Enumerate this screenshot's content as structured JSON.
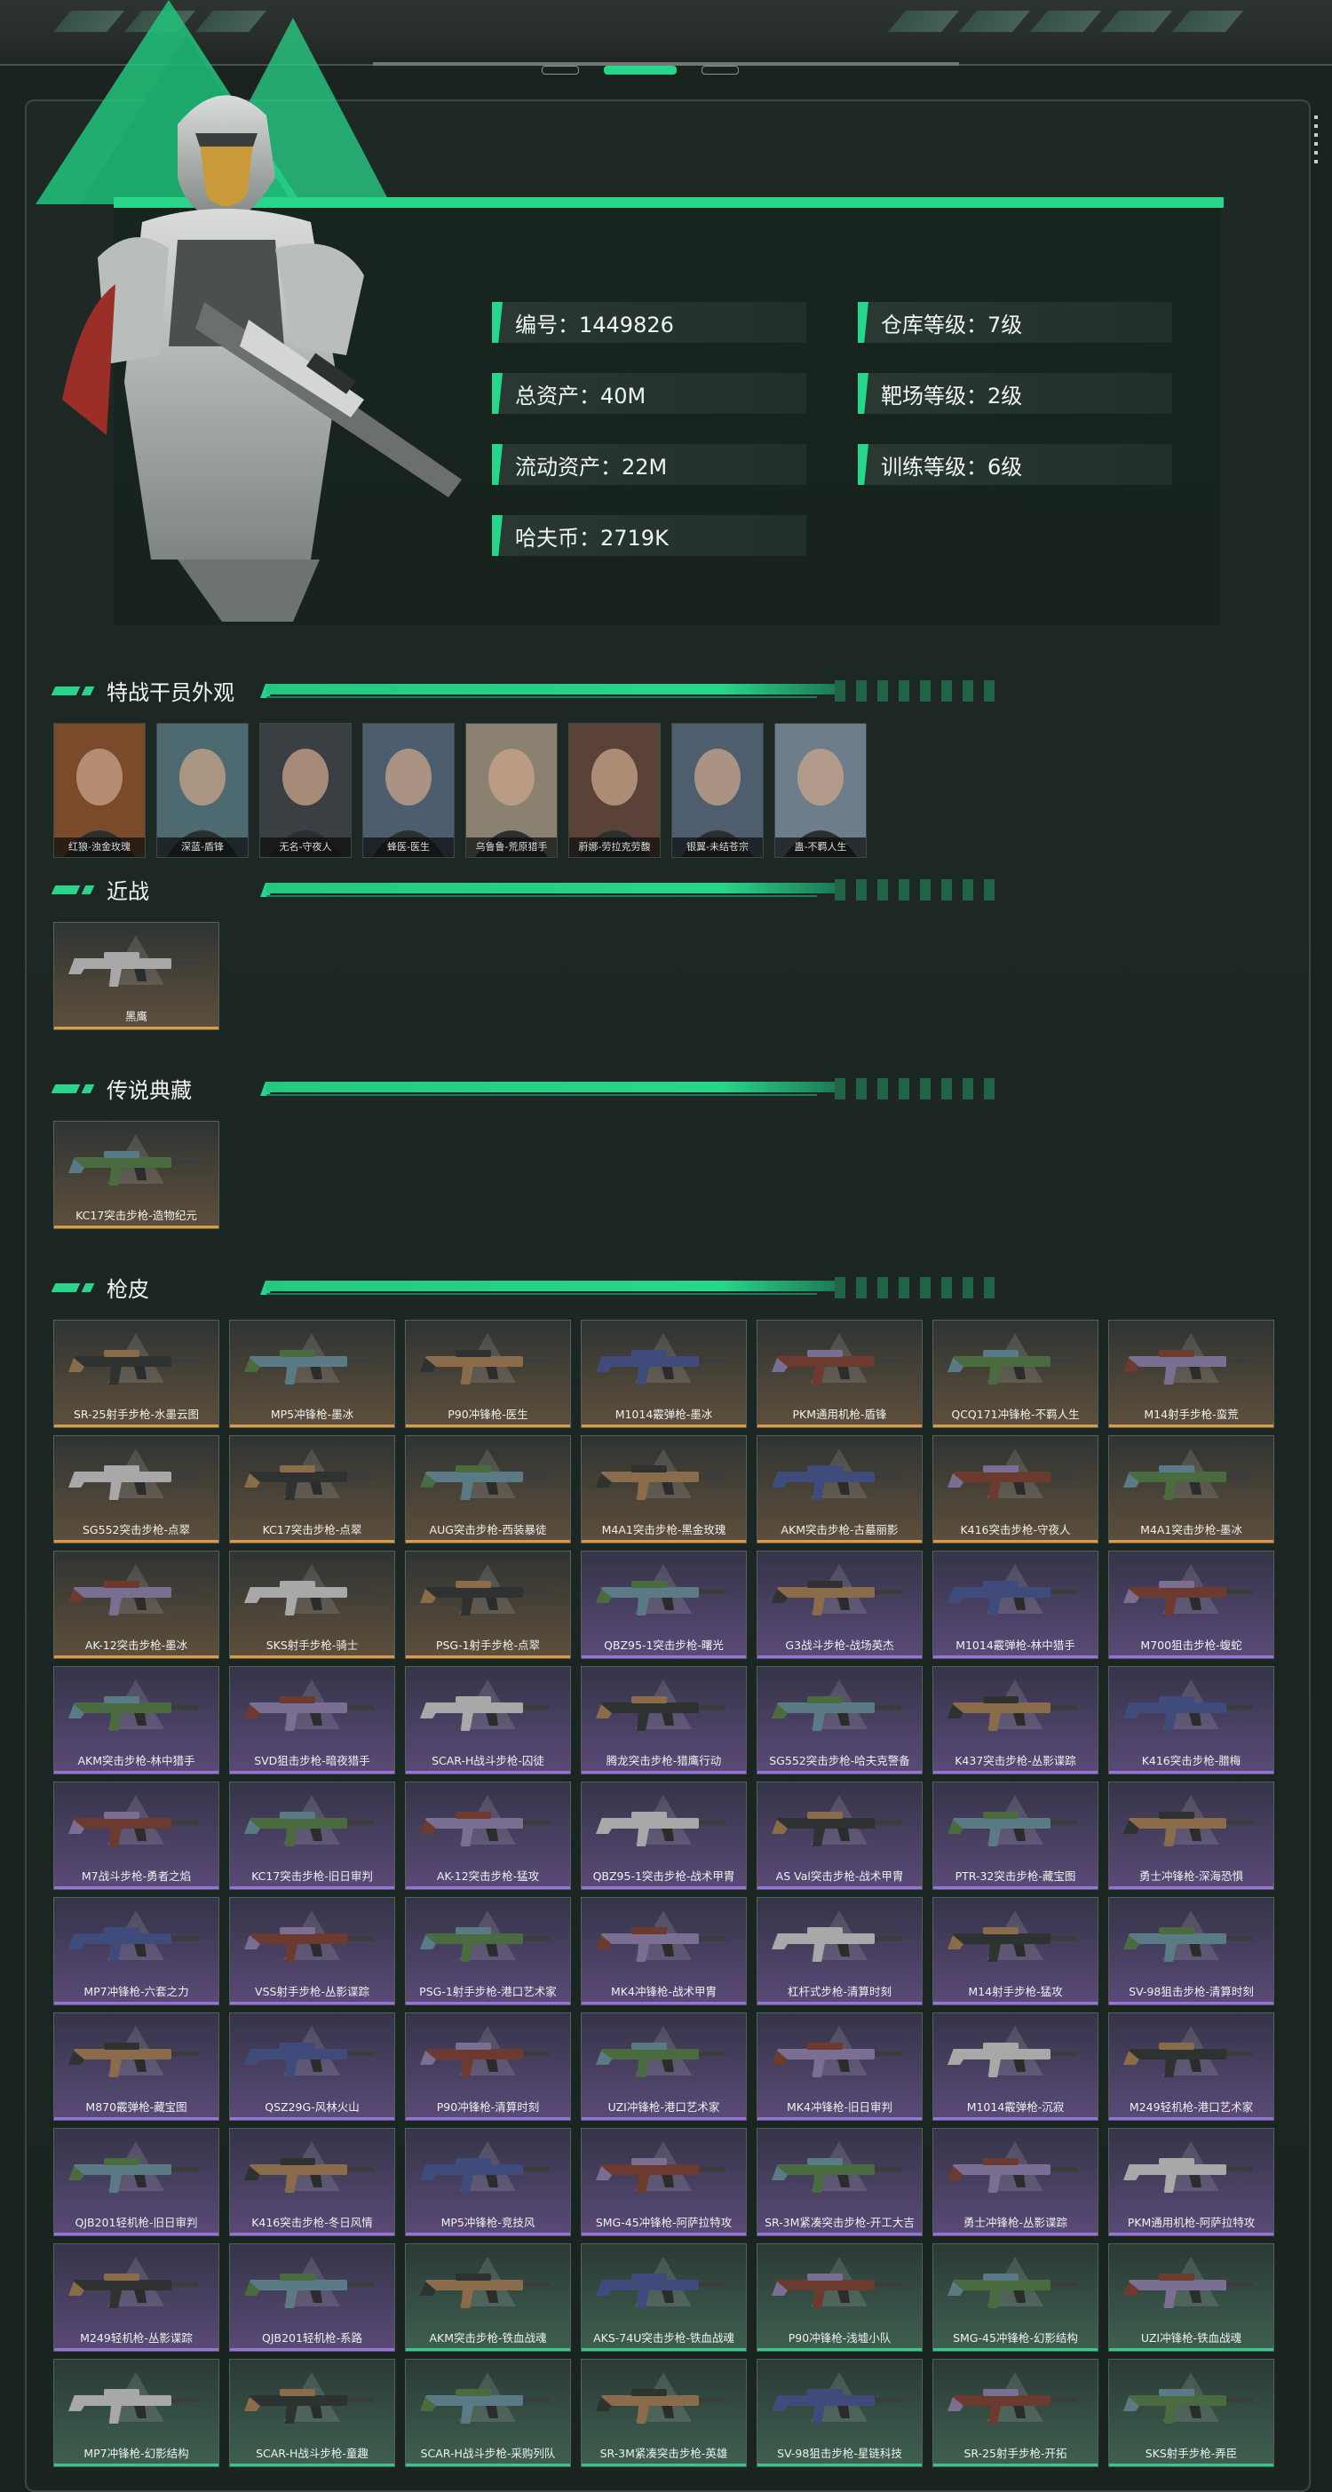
{
  "colors": {
    "accent": "#28d68b",
    "gold_rarity": "#e09a45",
    "purple_rarity": "#9a6fe0",
    "green_rarity": "#34c98a"
  },
  "profile": {
    "stats": [
      {
        "label": "编号：1449826"
      },
      {
        "label": "仓库等级：7级"
      },
      {
        "label": "总资产：40M"
      },
      {
        "label": "靶场等级：2级"
      },
      {
        "label": "流动资产：22M"
      },
      {
        "label": "训练等级：6级"
      },
      {
        "label": "哈夫币：2719K"
      }
    ]
  },
  "sections": {
    "operators": "特战干员外观",
    "melee": "近战",
    "legendary": "传说典藏",
    "skins": "枪皮"
  },
  "operators": [
    {
      "name": "红狼-浊金玫瑰"
    },
    {
      "name": "深蓝-盾锋"
    },
    {
      "name": "无名-守夜人"
    },
    {
      "name": "蜂医-医生"
    },
    {
      "name": "乌鲁鲁-荒原猎手"
    },
    {
      "name": "蔚娜-劳拉克劳馥"
    },
    {
      "name": "银翼-未结苍宗"
    },
    {
      "name": "蛊-不羁人生"
    }
  ],
  "melee": [
    {
      "name": "黑鹰",
      "rarity": "gold"
    }
  ],
  "legendary": [
    {
      "name": "KC17突击步枪-造物纪元",
      "rarity": "gold"
    }
  ],
  "skins": [
    {
      "name": "SR-25射手步枪-水墨云图",
      "rarity": "gold"
    },
    {
      "name": "MP5冲锋枪-墨冰",
      "rarity": "gold"
    },
    {
      "name": "P90冲锋枪-医生",
      "rarity": "gold"
    },
    {
      "name": "M1014霰弹枪-墨冰",
      "rarity": "gold"
    },
    {
      "name": "PKM通用机枪-盾锋",
      "rarity": "gold"
    },
    {
      "name": "QCQ171冲锋枪-不羁人生",
      "rarity": "gold"
    },
    {
      "name": "M14射手步枪-蛮荒",
      "rarity": "gold"
    },
    {
      "name": "SG552突击步枪-点翠",
      "rarity": "gold"
    },
    {
      "name": "KC17突击步枪-点翠",
      "rarity": "gold"
    },
    {
      "name": "AUG突击步枪-西装暴徒",
      "rarity": "gold"
    },
    {
      "name": "M4A1突击步枪-黑金玫瑰",
      "rarity": "gold"
    },
    {
      "name": "AKM突击步枪-古墓丽影",
      "rarity": "gold"
    },
    {
      "name": "K416突击步枪-守夜人",
      "rarity": "gold"
    },
    {
      "name": "M4A1突击步枪-墨冰",
      "rarity": "gold"
    },
    {
      "name": "AK-12突击步枪-墨冰",
      "rarity": "gold"
    },
    {
      "name": "SKS射手步枪-骑士",
      "rarity": "gold"
    },
    {
      "name": "PSG-1射手步枪-点翠",
      "rarity": "gold"
    },
    {
      "name": "QBZ95-1突击步枪-曙光",
      "rarity": "purple"
    },
    {
      "name": "G3战斗步枪-战场英杰",
      "rarity": "purple"
    },
    {
      "name": "M1014霰弹枪-林中猎手",
      "rarity": "purple"
    },
    {
      "name": "M700狙击步枪-蝮蛇",
      "rarity": "purple"
    },
    {
      "name": "AKM突击步枪-林中猎手",
      "rarity": "purple"
    },
    {
      "name": "SVD狙击步枪-暗夜猎手",
      "rarity": "purple"
    },
    {
      "name": "SCAR-H战斗步枪-囚徒",
      "rarity": "purple"
    },
    {
      "name": "腾龙突击步枪-猎鹰行动",
      "rarity": "purple"
    },
    {
      "name": "SG552突击步枪-哈夫克警备",
      "rarity": "purple"
    },
    {
      "name": "K437突击步枪-丛影谍踪",
      "rarity": "purple"
    },
    {
      "name": "K416突击步枪-腊梅",
      "rarity": "purple"
    },
    {
      "name": "M7战斗步枪-勇者之焰",
      "rarity": "purple"
    },
    {
      "name": "KC17突击步枪-旧日审判",
      "rarity": "purple"
    },
    {
      "name": "AK-12突击步枪-猛攻",
      "rarity": "purple"
    },
    {
      "name": "QBZ95-1突击步枪-战术甲胄",
      "rarity": "purple"
    },
    {
      "name": "AS Val突击步枪-战术甲胄",
      "rarity": "purple"
    },
    {
      "name": "PTR-32突击步枪-藏宝图",
      "rarity": "purple"
    },
    {
      "name": "勇士冲锋枪-深海恐惧",
      "rarity": "purple"
    },
    {
      "name": "MP7冲锋枪-六套之力",
      "rarity": "purple"
    },
    {
      "name": "VSS射手步枪-丛影谍踪",
      "rarity": "purple"
    },
    {
      "name": "PSG-1射手步枪-港口艺术家",
      "rarity": "purple"
    },
    {
      "name": "MK4冲锋枪-战术甲胄",
      "rarity": "purple"
    },
    {
      "name": "杠杆式步枪-清算时刻",
      "rarity": "purple"
    },
    {
      "name": "M14射手步枪-猛攻",
      "rarity": "purple"
    },
    {
      "name": "SV-98狙击步枪-清算时刻",
      "rarity": "purple"
    },
    {
      "name": "M870霰弹枪-藏宝图",
      "rarity": "purple"
    },
    {
      "name": "QSZ29G-风林火山",
      "rarity": "purple"
    },
    {
      "name": "P90冲锋枪-清算时刻",
      "rarity": "purple"
    },
    {
      "name": "UZI冲锋枪-港口艺术家",
      "rarity": "purple"
    },
    {
      "name": "MK4冲锋枪-旧日审判",
      "rarity": "purple"
    },
    {
      "name": "M1014霰弹枪-沉寂",
      "rarity": "purple"
    },
    {
      "name": "M249轻机枪-港口艺术家",
      "rarity": "purple"
    },
    {
      "name": "QJB201轻机枪-旧日审判",
      "rarity": "purple"
    },
    {
      "name": "K416突击步枪-冬日风情",
      "rarity": "purple"
    },
    {
      "name": "MP5冲锋枪-竞技风",
      "rarity": "purple"
    },
    {
      "name": "SMG-45冲锋枪-阿萨拉特攻",
      "rarity": "purple"
    },
    {
      "name": "SR-3M紧凑突击步枪-开工大吉",
      "rarity": "purple"
    },
    {
      "name": "勇士冲锋枪-丛影谍踪",
      "rarity": "purple"
    },
    {
      "name": "PKM通用机枪-阿萨拉特攻",
      "rarity": "purple"
    },
    {
      "name": "M249轻机枪-丛影谍踪",
      "rarity": "purple"
    },
    {
      "name": "QJB201轻机枪-系路",
      "rarity": "purple"
    },
    {
      "name": "AKM突击步枪-铁血战魂",
      "rarity": "green"
    },
    {
      "name": "AKS-74U突击步枪-铁血战魂",
      "rarity": "green"
    },
    {
      "name": "P90冲锋枪-浅墟小队",
      "rarity": "green"
    },
    {
      "name": "SMG-45冲锋枪-幻影结构",
      "rarity": "green"
    },
    {
      "name": "UZI冲锋枪-铁血战魂",
      "rarity": "green"
    },
    {
      "name": "MP7冲锋枪-幻影结构",
      "rarity": "green"
    },
    {
      "name": "SCAR-H战斗步枪-童趣",
      "rarity": "green"
    },
    {
      "name": "SCAR-H战斗步枪-采购列队",
      "rarity": "green"
    },
    {
      "name": "SR-3M紧凑突击步枪-英雄",
      "rarity": "green"
    },
    {
      "name": "SV-98狙击步枪-星链科技",
      "rarity": "green"
    },
    {
      "name": "SR-25射手步枪-开拓",
      "rarity": "green"
    },
    {
      "name": "SKS射手步枪-弄臣",
      "rarity": "green"
    }
  ]
}
